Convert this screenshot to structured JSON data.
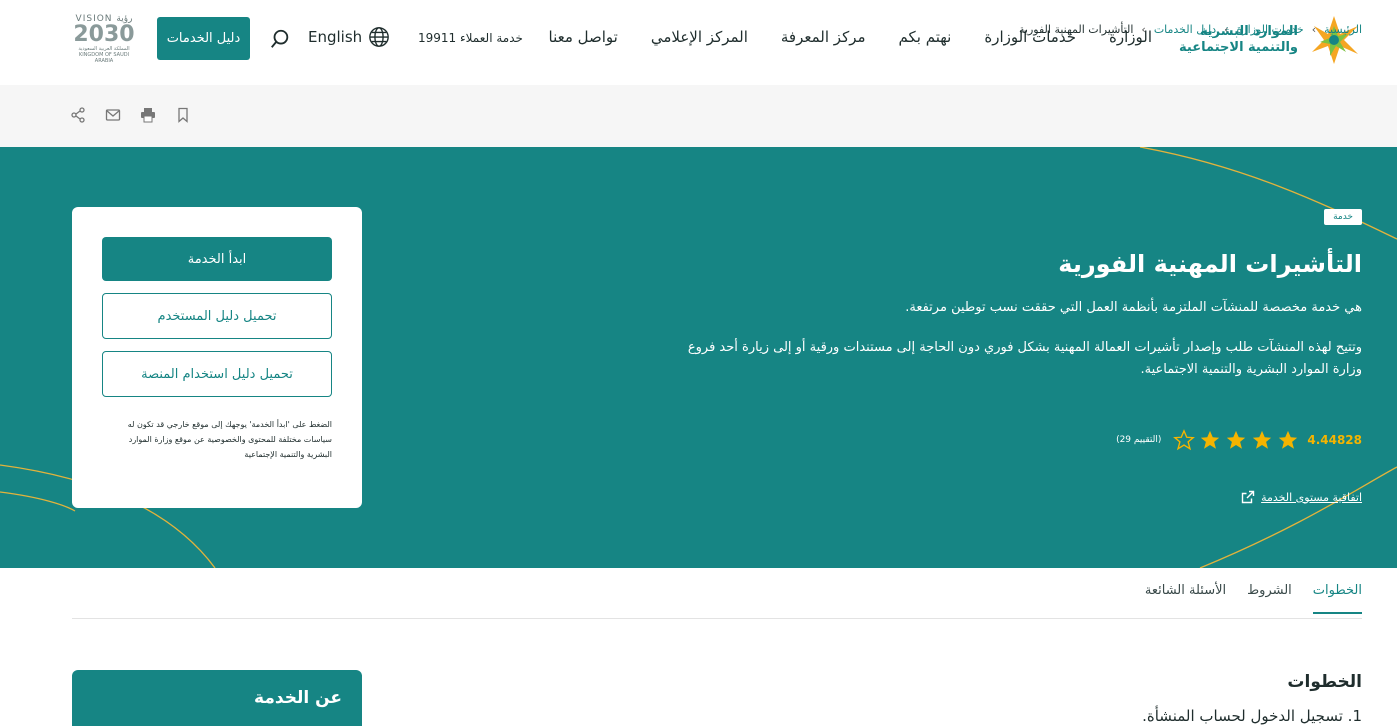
{
  "header": {
    "logo_line1": "الموارد البشرية",
    "logo_line2": "والتنمية الاجتماعية",
    "nav": [
      "الوزارة",
      "خدمات الوزارة",
      "نهتم بكم",
      "مركز المعرفة",
      "المركز الإعلامي",
      "تواصل معنا"
    ],
    "customer_service": "خدمة العملاء 19911",
    "language": "English",
    "guide_button": "دليل الخدمات",
    "vision_top": "VISION رؤية",
    "vision_year": "2030",
    "vision_sub": "المملكة العربية السعودية KINGDOM OF SAUDI ARABIA"
  },
  "breadcrumb": {
    "items": [
      "الرئيسية",
      "خدمات الوزارة",
      "دليل الخدمات",
      "التأشيرات المهنية الفورية"
    ]
  },
  "hero": {
    "tag": "خدمة",
    "title": "التأشيرات المهنية الفورية",
    "desc1": "هي خدمة مخصصة للمنشآت الملتزمة بأنظمة العمل التي حققت نسب توطين مرتفعة.",
    "desc2": "وتتيح لهذه المنشآت طلب وإصدار تأشيرات العمالة المهنية بشكل فوري دون الحاجة إلى مستندات ورقية أو إلى زيارة أحد فروع وزارة الموارد البشرية والتنمية الاجتماعية.",
    "rating_score": "4.44828",
    "rating_value": 4.44828,
    "rating_max": 5,
    "rating_count": "(التقييم 29)",
    "sla_link": "اتفاقية مستوى الخدمة"
  },
  "card": {
    "start_button": "ابدأ الخدمة",
    "user_guide_button": "تحميل دليل المستخدم",
    "platform_guide_button": "تحميل دليل استخدام المنصة",
    "note": "الضغط على 'ابدأ الخدمة' يوجهك إلى موقع خارجي قد تكون له سياسات مختلفة للمحتوى والخصوصية عن موقع وزارة الموارد البشرية والتنمية الإجتماعية"
  },
  "tabs": [
    "الخطوات",
    "الشروط",
    "الأسئلة الشائعة"
  ],
  "steps": {
    "title": "الخطوات",
    "step1": "1. تسجيل الدخول لحساب المنشأة."
  },
  "about": {
    "title": "عن الخدمة"
  },
  "colors": {
    "primary": "#168584",
    "star": "#f5b400",
    "accent_line": "#e2b33c"
  }
}
